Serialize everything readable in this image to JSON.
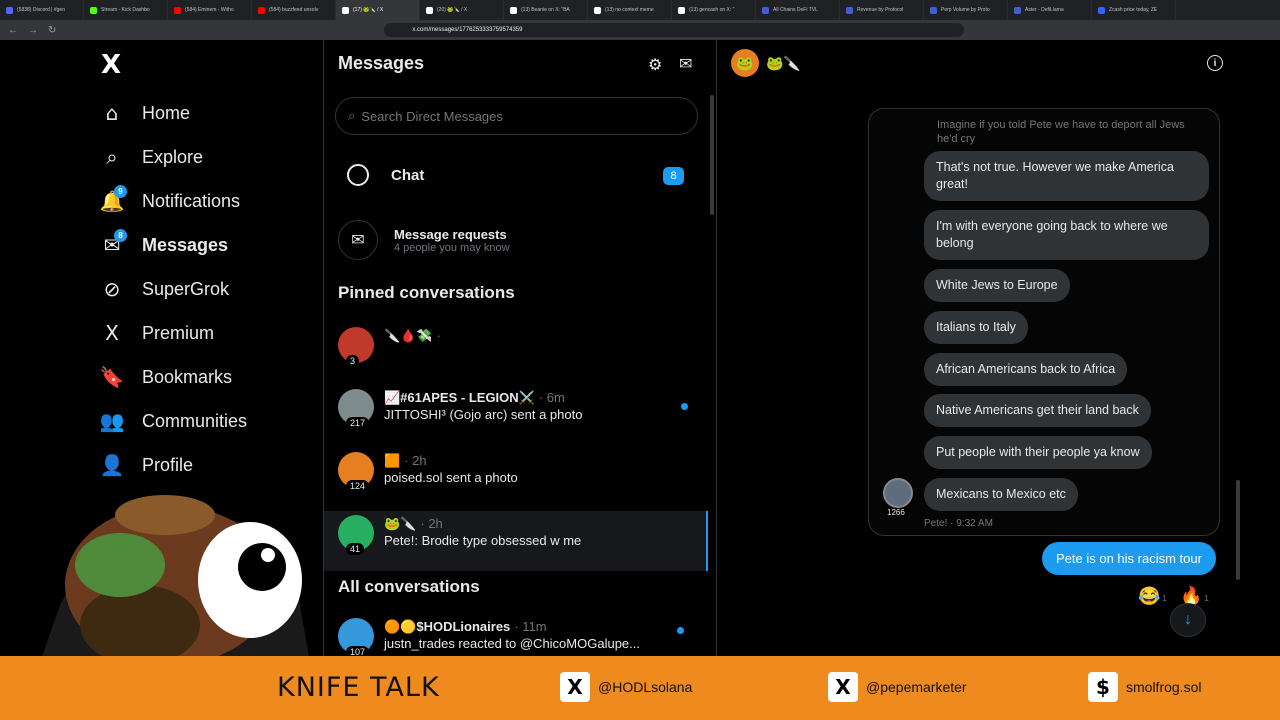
{
  "browser": {
    "tabs": [
      {
        "label": "(5838) Discord | #gen",
        "color": "#5865f2"
      },
      {
        "label": "Stream - Kick Dashbo",
        "color": "#53fc18"
      },
      {
        "label": "(584) Eminem - Witho",
        "color": "#ff0000"
      },
      {
        "label": "(584) buzzfeed unsolv",
        "color": "#ff0000"
      },
      {
        "label": "(17) 🐸🔪 / X",
        "color": "#ffffff"
      },
      {
        "label": "(20) 🐸🔪 / X",
        "color": "#ffffff"
      },
      {
        "label": "(13) Beanie on X: \"BA",
        "color": "#ffffff"
      },
      {
        "label": "(13) no context meme",
        "color": "#ffffff"
      },
      {
        "label": "(13) gencash on X: \"",
        "color": "#ffffff"
      },
      {
        "label": "All Chains DeFi TVL",
        "color": "#445ed0"
      },
      {
        "label": "Revenue by Protocol",
        "color": "#445ed0"
      },
      {
        "label": "Perp Volume by Proto",
        "color": "#445ed0"
      },
      {
        "label": "Aster - DefiLlama",
        "color": "#445ed0"
      },
      {
        "label": "Zcash price today, ZE",
        "color": "#3861fb"
      }
    ],
    "url": "x.com/messages/1776253333759574359"
  },
  "sidebar": {
    "logo": "X",
    "items": [
      {
        "label": "Home",
        "icon": "⌂",
        "badge": ""
      },
      {
        "label": "Explore",
        "icon": "⌕",
        "badge": ""
      },
      {
        "label": "Notifications",
        "icon": "🔔",
        "badge": "9"
      },
      {
        "label": "Messages",
        "icon": "✉",
        "badge": "8"
      },
      {
        "label": "SuperGrok",
        "icon": "⊘",
        "badge": ""
      },
      {
        "label": "Premium",
        "icon": "X",
        "badge": ""
      },
      {
        "label": "Bookmarks",
        "icon": "🔖",
        "badge": ""
      },
      {
        "label": "Communities",
        "icon": "👥",
        "badge": ""
      },
      {
        "label": "Profile",
        "icon": "👤",
        "badge": ""
      }
    ]
  },
  "messages": {
    "title": "Messages",
    "search_placeholder": "Search Direct Messages",
    "chat_label": "Chat",
    "chat_badge": "8",
    "requests_title": "Message requests",
    "requests_sub": "4 people you may know",
    "pinned_title": "Pinned conversations",
    "all_title": "All conversations",
    "pinned": [
      {
        "name": "🔪🩸💸",
        "time": "·",
        "preview": "",
        "count": "3",
        "avatar": "#c0392b",
        "unread": false,
        "selected": false
      },
      {
        "name": "📈#61APES - LEGION⚔️",
        "time": "· 6m",
        "preview": "JITTOSHI³ (Gojo arc) sent a photo",
        "count": "217",
        "avatar": "#7f8c8d",
        "unread": true,
        "selected": false
      },
      {
        "name": "🟧",
        "time": "· 2h",
        "preview": "poised.sol sent a photo",
        "count": "124",
        "avatar": "#e67e22",
        "unread": false,
        "selected": false
      },
      {
        "name": "🐸🔪",
        "time": "· 2h",
        "preview": "Pete!: Brodie type obsessed w me",
        "count": "41",
        "avatar": "#27ae60",
        "unread": false,
        "selected": true
      }
    ],
    "all": [
      {
        "name": "🟠🟡$HODLionaires",
        "time": "· 11m",
        "preview": "justn_trades reacted to @ChicoMOGalupe...",
        "count": "107",
        "avatar": "#3498db",
        "unread": true
      }
    ]
  },
  "conversation": {
    "header_name": "🐸🔪",
    "faded_text": "Imagine if you told Pete we have to deport all Jews he'd cry",
    "bubbles": [
      "That's not true. However we make America great!",
      "I'm with everyone going back to where we belong",
      "White Jews to Europe",
      "Italians to Italy",
      "African Americans back to Africa",
      "Native Americans get their land back",
      "Put people with their people ya know",
      "Mexicans to Mexico etc"
    ],
    "group_count": "1266",
    "meta": "Pete! · 9:32 AM",
    "sent": "Pete is on his racism tour",
    "reactions": [
      {
        "emoji": "😂",
        "count": "1"
      },
      {
        "emoji": "🔥",
        "count": "1"
      }
    ]
  },
  "overlay": {
    "title": "KNIFE TALK",
    "handles": [
      {
        "icon": "X",
        "text": "@HODLsolana"
      },
      {
        "icon": "X",
        "text": "@pepemarketer"
      },
      {
        "icon": "$",
        "text": "smolfrog.sol"
      }
    ]
  }
}
